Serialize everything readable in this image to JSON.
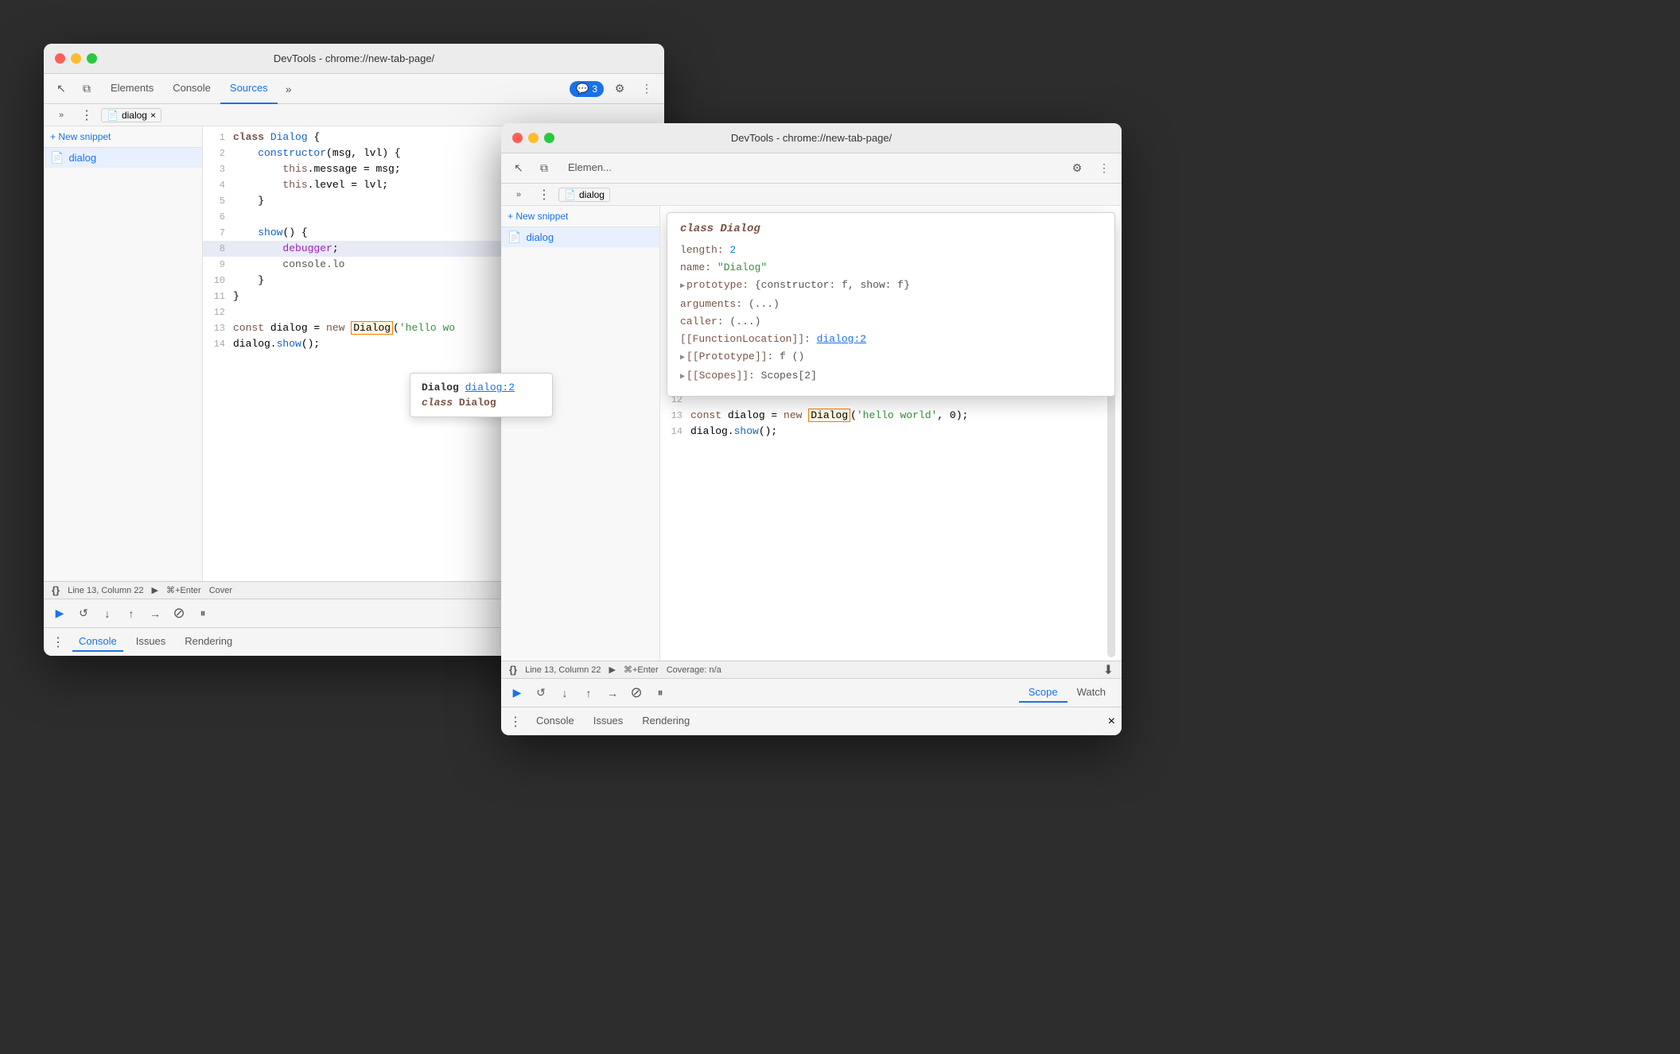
{
  "window1": {
    "title": "DevTools - chrome://new-tab-page/",
    "tabs": [
      {
        "label": "Elements",
        "active": false
      },
      {
        "label": "Console",
        "active": false
      },
      {
        "label": "Sources",
        "active": true
      }
    ],
    "more_tabs": "»",
    "badge": "3",
    "file_tab": "dialog",
    "sidebar": {
      "new_snippet": "+ New snippet",
      "items": [
        {
          "label": "dialog",
          "active": true
        }
      ]
    },
    "code": {
      "lines": [
        {
          "num": 1,
          "content": "class Dialog {"
        },
        {
          "num": 2,
          "content": "    constructor(msg, lvl) {"
        },
        {
          "num": 3,
          "content": "        this.message = msg;"
        },
        {
          "num": 4,
          "content": "        this.level = lvl;"
        },
        {
          "num": 5,
          "content": "    }"
        },
        {
          "num": 6,
          "content": ""
        },
        {
          "num": 7,
          "content": "    show() {"
        },
        {
          "num": 8,
          "content": "        debugger;",
          "highlighted": true
        },
        {
          "num": 9,
          "content": "        console.lo"
        },
        {
          "num": 10,
          "content": "    }"
        },
        {
          "num": 11,
          "content": "}"
        },
        {
          "num": 12,
          "content": ""
        },
        {
          "num": 13,
          "content": "const dialog = new Dialog('hello wo"
        },
        {
          "num": 14,
          "content": "dialog.show();"
        }
      ]
    },
    "status": {
      "curly": "{}",
      "position": "Line 13, Column 22",
      "run": "⌘+Enter",
      "coverage": "Cover"
    },
    "debug_tabs": [
      {
        "label": "Scope",
        "active": true
      },
      {
        "label": "Watch",
        "active": false
      }
    ],
    "bottom_tabs": [
      {
        "label": "Console",
        "active": true
      },
      {
        "label": "Issues",
        "active": false
      },
      {
        "label": "Rendering",
        "active": false
      }
    ],
    "tooltip": {
      "title": "Dialog",
      "link": "dialog:2",
      "class_label": "class Dialog"
    }
  },
  "window2": {
    "title": "DevTools - chrome://new-tab-page/",
    "tabs": [
      {
        "label": "Elemen...",
        "active": false
      }
    ],
    "file_tab": "dialog",
    "sidebar": {
      "new_snippet": "+ New snippet",
      "items": [
        {
          "label": "dialog",
          "active": true
        }
      ]
    },
    "object_popup": {
      "title": "class Dialog",
      "rows": [
        {
          "key": "length:",
          "value": "2",
          "type": "num"
        },
        {
          "key": "name:",
          "value": "\"Dialog\"",
          "type": "str"
        },
        {
          "key": "prototype:",
          "value": "{constructor: f, show: f}",
          "type": "obj",
          "expandable": true
        },
        {
          "key": "arguments:",
          "value": "(...)",
          "type": "plain"
        },
        {
          "key": "caller:",
          "value": "(...)",
          "type": "plain"
        },
        {
          "key": "[[FunctionLocation]]:",
          "value": "dialog:2",
          "type": "link"
        },
        {
          "key": "[[Prototype]]:",
          "value": "f ()",
          "type": "plain",
          "expandable": true
        },
        {
          "key": "[[Scopes]]:",
          "value": "Scopes[2]",
          "type": "plain",
          "expandable": true
        }
      ]
    },
    "code": {
      "lines": [
        {
          "num": 12,
          "content": ""
        },
        {
          "num": 13,
          "content": "const dialog = new Dialog('hello world', 0);"
        },
        {
          "num": 14,
          "content": "dialog.show();"
        }
      ]
    },
    "status": {
      "curly": "{}",
      "position": "Line 13, Column 22",
      "run": "⌘+Enter",
      "coverage": "Coverage: n/a"
    },
    "debug_tabs": [
      {
        "label": "Scope",
        "active": true
      },
      {
        "label": "Watch",
        "active": false
      }
    ],
    "bottom_tabs": [
      {
        "label": "Console",
        "active": false
      },
      {
        "label": "Issues",
        "active": false
      },
      {
        "label": "Rendering",
        "active": false
      }
    ]
  },
  "icons": {
    "cursor": "↖",
    "layers": "⧉",
    "more": "»",
    "settings": "⚙",
    "three_dots": "⋮",
    "play": "▶",
    "step_over": "↺",
    "step_into": "↓",
    "step_out": "↑",
    "step": "→",
    "deactivate": "⊘",
    "pause": "⏸",
    "file_snippet": "📄",
    "close": "×",
    "expand_right": "▶",
    "expand_down": "▼"
  }
}
